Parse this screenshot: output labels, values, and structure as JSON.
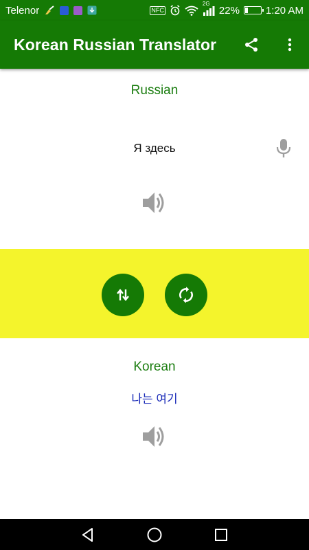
{
  "status_bar": {
    "carrier": "Telenor",
    "nfc": "NFC",
    "network": "2G",
    "battery": "22%",
    "battery_level": 0.22,
    "time": "1:20 AM"
  },
  "app_bar": {
    "title": "Korean Russian Translator",
    "share_icon": "share-icon",
    "menu_icon": "more-vert-icon"
  },
  "source": {
    "language": "Russian",
    "text": "Я здесь"
  },
  "target": {
    "language": "Korean",
    "text": "나는 여기"
  },
  "colors": {
    "primary": "#157a05",
    "band": "#f4f42c",
    "label": "#1b7d10",
    "translation": "#1a2bb8",
    "icon_gray": "#9e9e9e"
  }
}
